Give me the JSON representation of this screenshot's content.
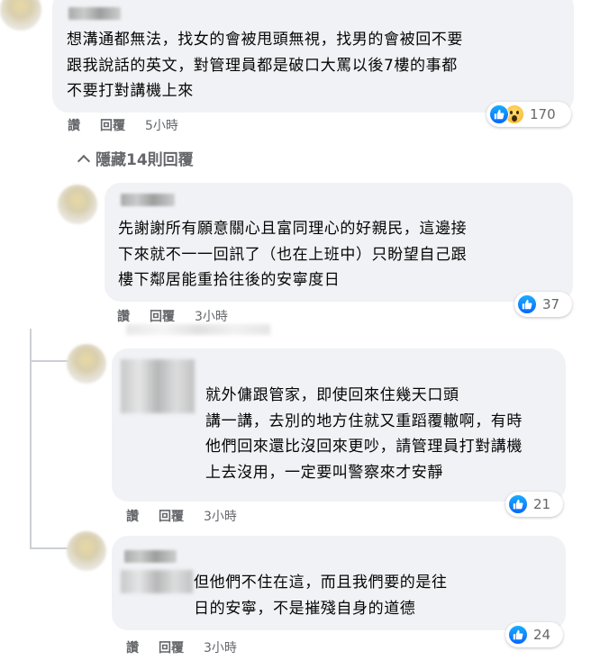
{
  "comments": [
    {
      "text": "想溝通都無法，找女的會被甩頭無視，找男的會被回不要\n跟我說話的英文，對管理員都是破口大罵以後7樓的事都\n不要打對講機上來",
      "actions": {
        "like": "讚",
        "reply": "回覆",
        "time": "5小時"
      },
      "reactions": {
        "icons": [
          "like-icon",
          "wow-icon"
        ],
        "count": "170"
      }
    },
    {
      "text": "先謝謝所有願意關心且富同理心的好親民，這邊接\n下來就不一一回訊了（也在上班中）只盼望自己跟\n樓下鄰居能重拾往後的安寧度日",
      "actions": {
        "like": "讚",
        "reply": "回覆",
        "time": "3小時"
      },
      "reactions": {
        "icons": [
          "like-icon"
        ],
        "count": "37"
      }
    },
    {
      "text": "就外傭跟管家，即使回來住幾天口頭\n講一講，去別的地方住就又重蹈覆轍啊，有時\n他們回來還比沒回來更吵，請管理員打對講機\n上去沒用，一定要叫警察來才安靜",
      "actions": {
        "like": "讚",
        "reply": "回覆",
        "time": "3小時"
      },
      "reactions": {
        "icons": [
          "like-icon"
        ],
        "count": "21"
      }
    },
    {
      "text": "但他們不住在這，而且我們要的是往\n日的安寧，不是摧殘自身的道德",
      "actions": {
        "like": "讚",
        "reply": "回覆",
        "time": "3小時"
      },
      "reactions": {
        "icons": [
          "like-icon"
        ],
        "count": "24"
      }
    }
  ],
  "hide_replies": {
    "label": "隱藏14則回覆",
    "icon": "chevron-up-icon"
  },
  "colors": {
    "bubble": "#f0f2f5",
    "meta": "#65676b",
    "like": "#0766ff"
  }
}
